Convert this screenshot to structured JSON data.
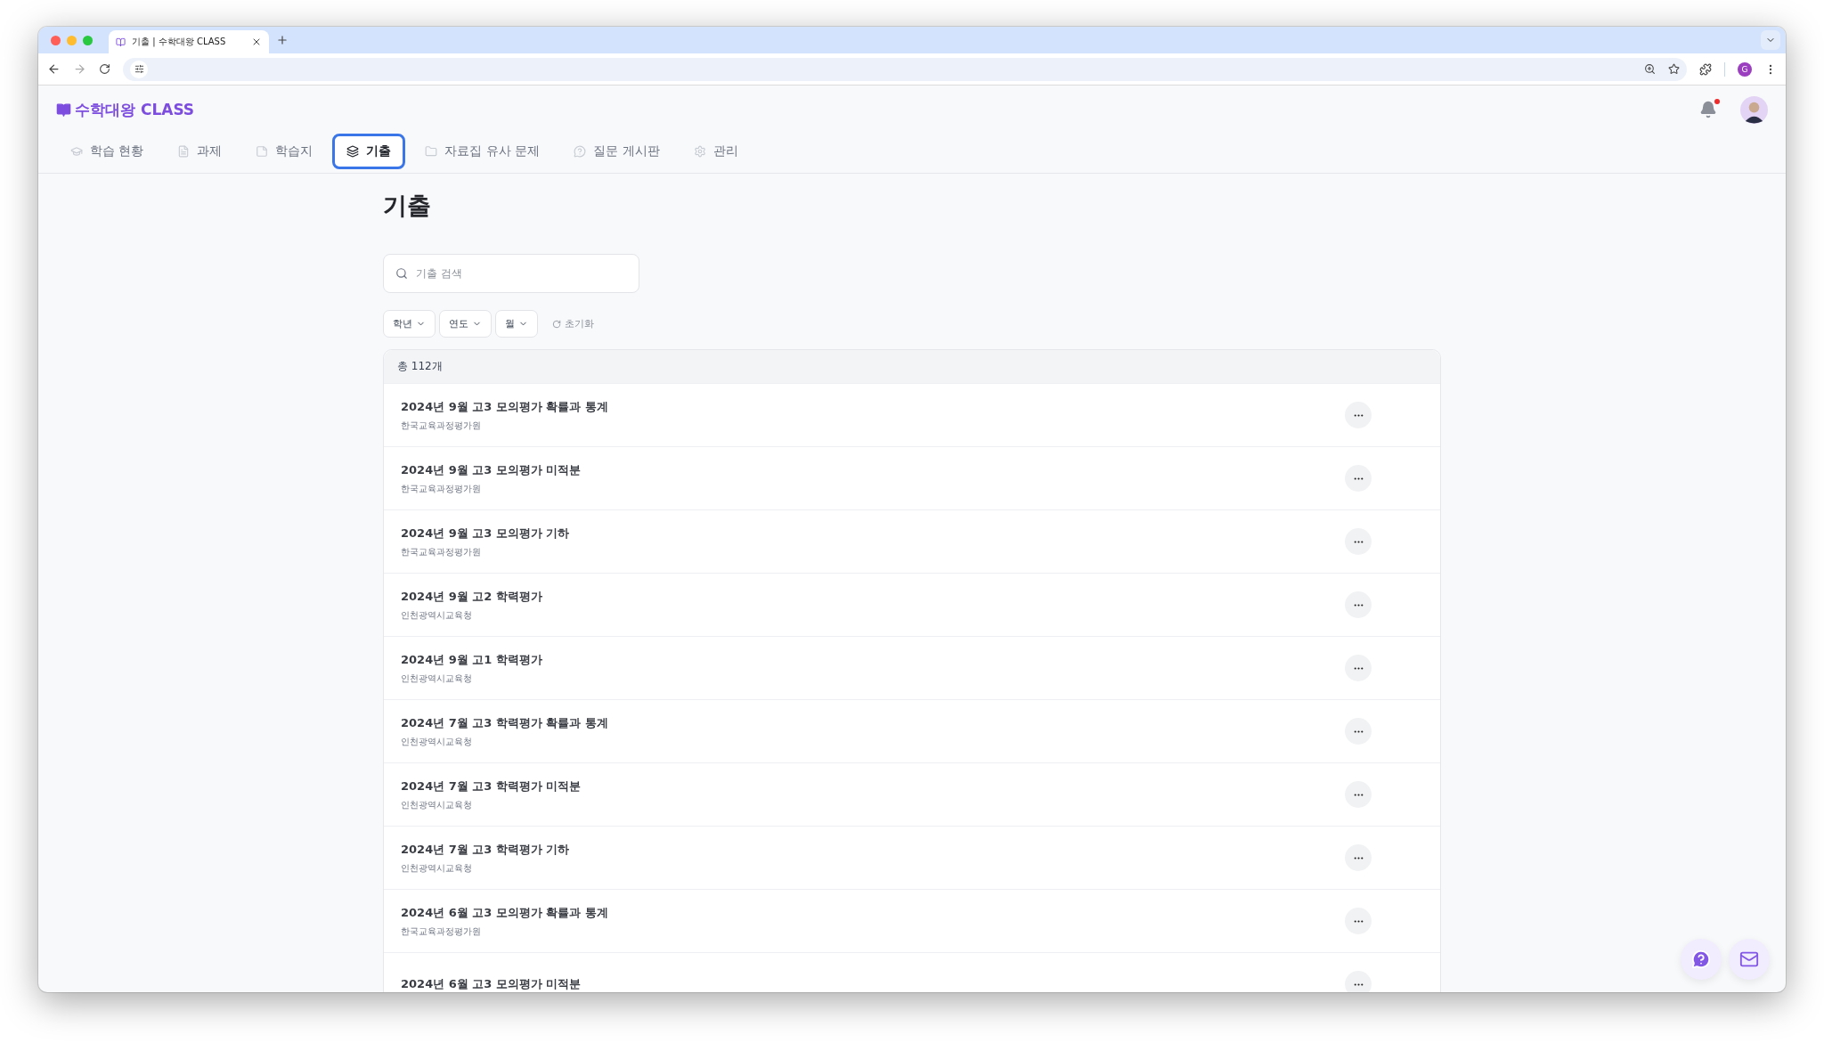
{
  "browser": {
    "tab_title": "기출 | 수학대왕 CLASS",
    "profile_initial": "G"
  },
  "header": {
    "logo": "수학대왕 CLASS",
    "notification": {
      "unread": true
    }
  },
  "nav": [
    {
      "label": "학습 현황",
      "selected": false
    },
    {
      "label": "과제",
      "selected": false
    },
    {
      "label": "학습지",
      "selected": false
    },
    {
      "label": "기출",
      "selected": true
    },
    {
      "label": "자료집 유사 문제",
      "selected": false
    },
    {
      "label": "질문 게시판",
      "selected": false
    },
    {
      "label": "관리",
      "selected": false
    }
  ],
  "page_title": "기출",
  "search": {
    "placeholder": "기출 검색"
  },
  "filters": [
    {
      "label": "학년"
    },
    {
      "label": "연도"
    },
    {
      "label": "월"
    }
  ],
  "reset": "초기화",
  "total": "총 112개",
  "exams": [
    {
      "title": "2024년 9월 고3 모의평가 확률과 통계",
      "publisher": "한국교육과정평가원"
    },
    {
      "title": "2024년 9월 고3 모의평가 미적분",
      "publisher": "한국교육과정평가원"
    },
    {
      "title": "2024년 9월 고3 모의평가 기하",
      "publisher": "한국교육과정평가원"
    },
    {
      "title": "2024년 9월 고2 학력평가",
      "publisher": "인천광역시교육청"
    },
    {
      "title": "2024년 9월 고1 학력평가",
      "publisher": "인천광역시교육청"
    },
    {
      "title": "2024년 7월 고3 학력평가 확률과 통계",
      "publisher": "인천광역시교육청"
    },
    {
      "title": "2024년 7월 고3 학력평가 미적분",
      "publisher": "인천광역시교육청"
    },
    {
      "title": "2024년 7월 고3 학력평가 기하",
      "publisher": "인천광역시교육청"
    },
    {
      "title": "2024년 6월 고3 모의평가 확률과 통계",
      "publisher": "한국교육과정평가원"
    },
    {
      "title": "2024년 6월 고3 모의평가 미적분"
    }
  ]
}
